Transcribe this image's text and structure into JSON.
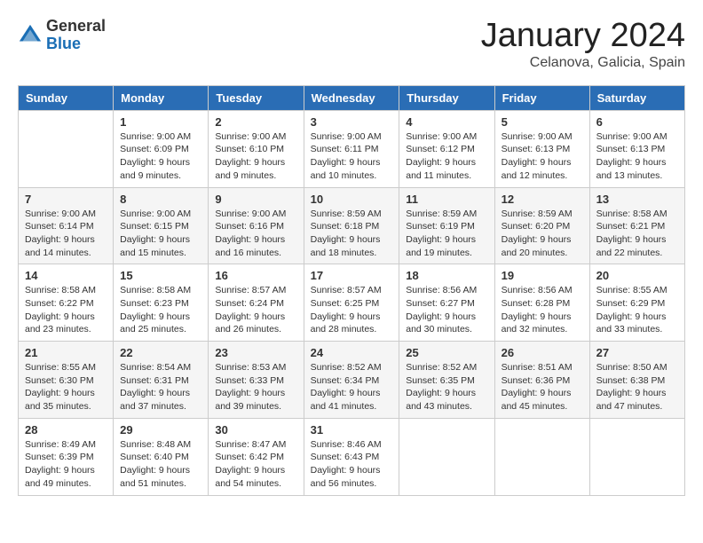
{
  "logo": {
    "general": "General",
    "blue": "Blue"
  },
  "header": {
    "month": "January 2024",
    "location": "Celanova, Galicia, Spain"
  },
  "days_of_week": [
    "Sunday",
    "Monday",
    "Tuesday",
    "Wednesday",
    "Thursday",
    "Friday",
    "Saturday"
  ],
  "weeks": [
    [
      {
        "day": "",
        "info": ""
      },
      {
        "day": "1",
        "info": "Sunrise: 9:00 AM\nSunset: 6:09 PM\nDaylight: 9 hours\nand 9 minutes."
      },
      {
        "day": "2",
        "info": "Sunrise: 9:00 AM\nSunset: 6:10 PM\nDaylight: 9 hours\nand 9 minutes."
      },
      {
        "day": "3",
        "info": "Sunrise: 9:00 AM\nSunset: 6:11 PM\nDaylight: 9 hours\nand 10 minutes."
      },
      {
        "day": "4",
        "info": "Sunrise: 9:00 AM\nSunset: 6:12 PM\nDaylight: 9 hours\nand 11 minutes."
      },
      {
        "day": "5",
        "info": "Sunrise: 9:00 AM\nSunset: 6:13 PM\nDaylight: 9 hours\nand 12 minutes."
      },
      {
        "day": "6",
        "info": "Sunrise: 9:00 AM\nSunset: 6:13 PM\nDaylight: 9 hours\nand 13 minutes."
      }
    ],
    [
      {
        "day": "7",
        "info": "Sunrise: 9:00 AM\nSunset: 6:14 PM\nDaylight: 9 hours\nand 14 minutes."
      },
      {
        "day": "8",
        "info": "Sunrise: 9:00 AM\nSunset: 6:15 PM\nDaylight: 9 hours\nand 15 minutes."
      },
      {
        "day": "9",
        "info": "Sunrise: 9:00 AM\nSunset: 6:16 PM\nDaylight: 9 hours\nand 16 minutes."
      },
      {
        "day": "10",
        "info": "Sunrise: 8:59 AM\nSunset: 6:18 PM\nDaylight: 9 hours\nand 18 minutes."
      },
      {
        "day": "11",
        "info": "Sunrise: 8:59 AM\nSunset: 6:19 PM\nDaylight: 9 hours\nand 19 minutes."
      },
      {
        "day": "12",
        "info": "Sunrise: 8:59 AM\nSunset: 6:20 PM\nDaylight: 9 hours\nand 20 minutes."
      },
      {
        "day": "13",
        "info": "Sunrise: 8:58 AM\nSunset: 6:21 PM\nDaylight: 9 hours\nand 22 minutes."
      }
    ],
    [
      {
        "day": "14",
        "info": "Sunrise: 8:58 AM\nSunset: 6:22 PM\nDaylight: 9 hours\nand 23 minutes."
      },
      {
        "day": "15",
        "info": "Sunrise: 8:58 AM\nSunset: 6:23 PM\nDaylight: 9 hours\nand 25 minutes."
      },
      {
        "day": "16",
        "info": "Sunrise: 8:57 AM\nSunset: 6:24 PM\nDaylight: 9 hours\nand 26 minutes."
      },
      {
        "day": "17",
        "info": "Sunrise: 8:57 AM\nSunset: 6:25 PM\nDaylight: 9 hours\nand 28 minutes."
      },
      {
        "day": "18",
        "info": "Sunrise: 8:56 AM\nSunset: 6:27 PM\nDaylight: 9 hours\nand 30 minutes."
      },
      {
        "day": "19",
        "info": "Sunrise: 8:56 AM\nSunset: 6:28 PM\nDaylight: 9 hours\nand 32 minutes."
      },
      {
        "day": "20",
        "info": "Sunrise: 8:55 AM\nSunset: 6:29 PM\nDaylight: 9 hours\nand 33 minutes."
      }
    ],
    [
      {
        "day": "21",
        "info": "Sunrise: 8:55 AM\nSunset: 6:30 PM\nDaylight: 9 hours\nand 35 minutes."
      },
      {
        "day": "22",
        "info": "Sunrise: 8:54 AM\nSunset: 6:31 PM\nDaylight: 9 hours\nand 37 minutes."
      },
      {
        "day": "23",
        "info": "Sunrise: 8:53 AM\nSunset: 6:33 PM\nDaylight: 9 hours\nand 39 minutes."
      },
      {
        "day": "24",
        "info": "Sunrise: 8:52 AM\nSunset: 6:34 PM\nDaylight: 9 hours\nand 41 minutes."
      },
      {
        "day": "25",
        "info": "Sunrise: 8:52 AM\nSunset: 6:35 PM\nDaylight: 9 hours\nand 43 minutes."
      },
      {
        "day": "26",
        "info": "Sunrise: 8:51 AM\nSunset: 6:36 PM\nDaylight: 9 hours\nand 45 minutes."
      },
      {
        "day": "27",
        "info": "Sunrise: 8:50 AM\nSunset: 6:38 PM\nDaylight: 9 hours\nand 47 minutes."
      }
    ],
    [
      {
        "day": "28",
        "info": "Sunrise: 8:49 AM\nSunset: 6:39 PM\nDaylight: 9 hours\nand 49 minutes."
      },
      {
        "day": "29",
        "info": "Sunrise: 8:48 AM\nSunset: 6:40 PM\nDaylight: 9 hours\nand 51 minutes."
      },
      {
        "day": "30",
        "info": "Sunrise: 8:47 AM\nSunset: 6:42 PM\nDaylight: 9 hours\nand 54 minutes."
      },
      {
        "day": "31",
        "info": "Sunrise: 8:46 AM\nSunset: 6:43 PM\nDaylight: 9 hours\nand 56 minutes."
      },
      {
        "day": "",
        "info": ""
      },
      {
        "day": "",
        "info": ""
      },
      {
        "day": "",
        "info": ""
      }
    ]
  ]
}
